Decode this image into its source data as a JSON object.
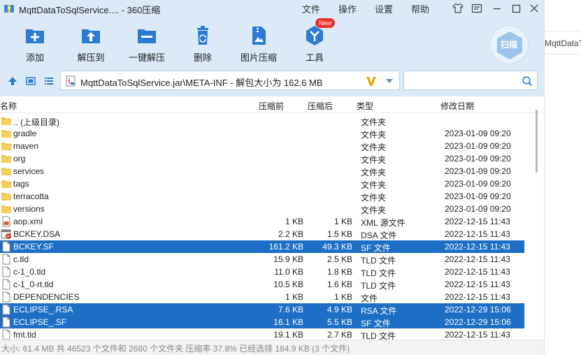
{
  "window": {
    "title": "MqttDataToSqlService.... - 360压缩",
    "menus": [
      "文件",
      "操作",
      "设置",
      "帮助"
    ]
  },
  "toolbar": {
    "tools": [
      {
        "label": "添加",
        "icon": "add-icon"
      },
      {
        "label": "解压到",
        "icon": "extract-to-icon"
      },
      {
        "label": "一键解压",
        "icon": "one-click-extract-icon"
      },
      {
        "label": "删除",
        "icon": "trash-icon"
      },
      {
        "label": "图片压缩",
        "icon": "image-compress-icon"
      },
      {
        "label": "工具",
        "icon": "tools-icon"
      }
    ],
    "new_badge": "New",
    "scan_label": "扫描"
  },
  "address": {
    "path": "MqttDataToSqlService.jar\\META-INF - 解包大小为 162.6 MB",
    "search_placeholder": ""
  },
  "side_peek": "MqttDataTo",
  "columns": {
    "name": "名称",
    "size": "压缩前",
    "compressed": "压缩后",
    "type": "类型",
    "modified": "修改日期"
  },
  "files": [
    {
      "name": ".. (上级目录)",
      "size": "",
      "compressed": "",
      "type": "文件夹",
      "date": "",
      "icon": "folder",
      "selected": false
    },
    {
      "name": "gradle",
      "size": "",
      "compressed": "",
      "type": "文件夹",
      "date": "2023-01-09 09:20",
      "icon": "folder",
      "selected": false
    },
    {
      "name": "maven",
      "size": "",
      "compressed": "",
      "type": "文件夹",
      "date": "2023-01-09 09:20",
      "icon": "folder",
      "selected": false
    },
    {
      "name": "org",
      "size": "",
      "compressed": "",
      "type": "文件夹",
      "date": "2023-01-09 09:20",
      "icon": "folder",
      "selected": false
    },
    {
      "name": "services",
      "size": "",
      "compressed": "",
      "type": "文件夹",
      "date": "2023-01-09 09:20",
      "icon": "folder",
      "selected": false
    },
    {
      "name": "tags",
      "size": "",
      "compressed": "",
      "type": "文件夹",
      "date": "2023-01-09 09:20",
      "icon": "folder",
      "selected": false
    },
    {
      "name": "terracotta",
      "size": "",
      "compressed": "",
      "type": "文件夹",
      "date": "2023-01-09 09:20",
      "icon": "folder",
      "selected": false
    },
    {
      "name": "versions",
      "size": "",
      "compressed": "",
      "type": "文件夹",
      "date": "2023-01-09 09:20",
      "icon": "folder",
      "selected": false
    },
    {
      "name": "aop.xml",
      "size": "1 KB",
      "compressed": "1 KB",
      "type": "XML 源文件",
      "date": "2022-12-15 11:43",
      "icon": "xml",
      "selected": false
    },
    {
      "name": "BCKEY.DSA",
      "size": "2.2 KB",
      "compressed": "1.5 KB",
      "type": "DSA 文件",
      "date": "2022-12-15 11:43",
      "icon": "dsa",
      "selected": false
    },
    {
      "name": "BCKEY.SF",
      "size": "161.2 KB",
      "compressed": "49.3 KB",
      "type": "SF 文件",
      "date": "2022-12-15 11:43",
      "icon": "file",
      "selected": true
    },
    {
      "name": "c.tld",
      "size": "15.9 KB",
      "compressed": "2.5 KB",
      "type": "TLD 文件",
      "date": "2022-12-15 11:43",
      "icon": "file",
      "selected": false
    },
    {
      "name": "c-1_0.tld",
      "size": "11.0 KB",
      "compressed": "1.8 KB",
      "type": "TLD 文件",
      "date": "2022-12-15 11:43",
      "icon": "file",
      "selected": false
    },
    {
      "name": "c-1_0-rt.tld",
      "size": "10.5 KB",
      "compressed": "1.6 KB",
      "type": "TLD 文件",
      "date": "2022-12-15 11:43",
      "icon": "file",
      "selected": false
    },
    {
      "name": "DEPENDENCIES",
      "size": "1 KB",
      "compressed": "1 KB",
      "type": "文件",
      "date": "2022-12-15 11:43",
      "icon": "file",
      "selected": false
    },
    {
      "name": "ECLIPSE_.RSA",
      "size": "7.6 KB",
      "compressed": "4.9 KB",
      "type": "RSA 文件",
      "date": "2022-12-29 15:06",
      "icon": "file",
      "selected": true
    },
    {
      "name": "ECLIPSE_.SF",
      "size": "16.1 KB",
      "compressed": "5.5 KB",
      "type": "SF 文件",
      "date": "2022-12-29 15:06",
      "icon": "file",
      "selected": true
    },
    {
      "name": "fmt.tld",
      "size": "19.1 KB",
      "compressed": "2.7 KB",
      "type": "TLD 文件",
      "date": "2022-12-15 11:43",
      "icon": "file",
      "selected": false
    }
  ],
  "status_text": "大小: 61.4 MB 共 46523 个文件和 2680 个文件夹 压缩率 37.8% 已经选择 184.9 KB (3 个文件)",
  "colors": {
    "chrome": "#dceaf7",
    "selection": "#1d6fc6",
    "accent": "#2a7bd1",
    "badge": "#e8332d"
  }
}
